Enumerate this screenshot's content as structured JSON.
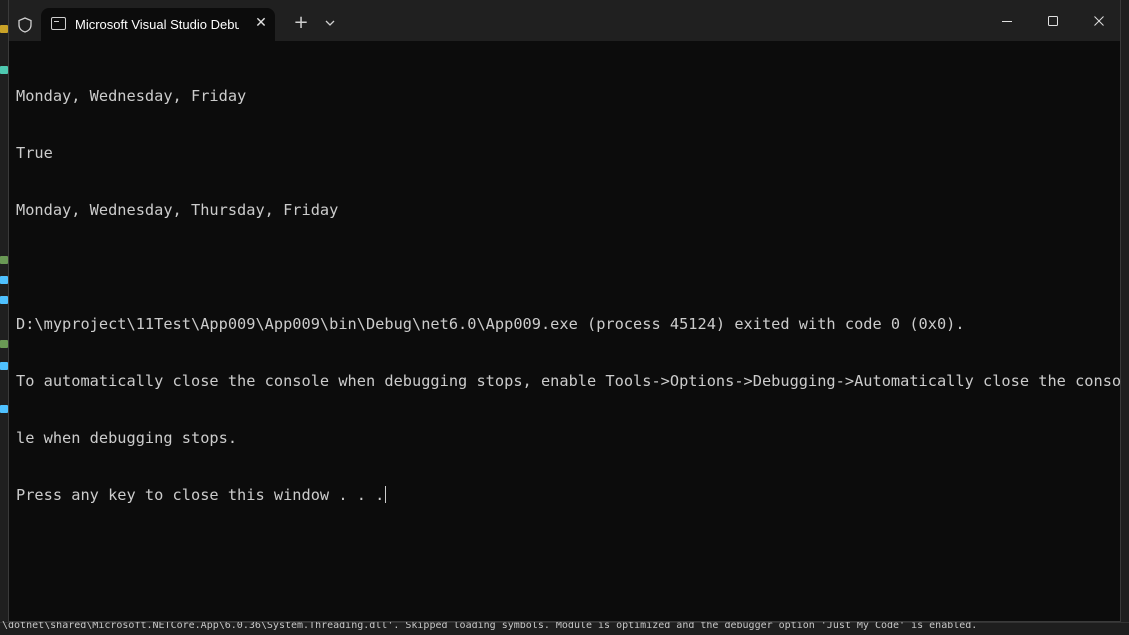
{
  "window": {
    "tab_title": "Microsoft Visual Studio Debug Console",
    "tab_icon": "console-icon",
    "shield_icon": "shield-icon",
    "new_tab_glyph": "+",
    "tab_close_glyph": "✕"
  },
  "console": {
    "lines": [
      "Monday, Wednesday, Friday",
      "True",
      "Monday, Wednesday, Thursday, Friday",
      "",
      "D:\\myproject\\11Test\\App009\\App009\\bin\\Debug\\net6.0\\App009.exe (process 45124) exited with code 0 (0x0).",
      "To automatically close the console when debugging stops, enable Tools->Options->Debugging->Automatically close the conso",
      "le when debugging stops.",
      "Press any key to close this window . . ."
    ]
  },
  "background": {
    "output_line": "\\dotnet\\shared\\Microsoft.NETCore.App\\6.0.36\\System.Threading.dll'. Skipped loading symbols. Module is optimized and the debugger option 'Just My Code' is enabled."
  },
  "colors": {
    "console_bg": "#0c0c0c",
    "console_text": "#cccccc",
    "titlebar_bg": "#202020"
  }
}
